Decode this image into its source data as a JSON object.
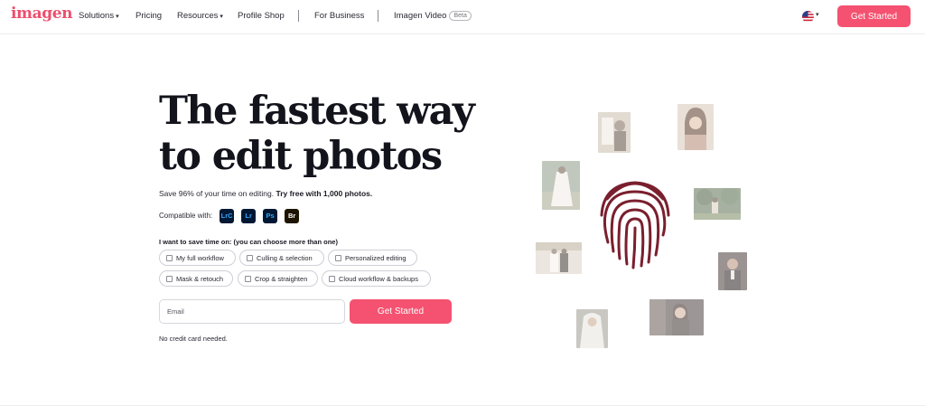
{
  "nav": {
    "logo": "imagen",
    "items": [
      {
        "label": "Solutions",
        "dropdown": true
      },
      {
        "label": "Pricing",
        "dropdown": false
      },
      {
        "label": "Resources",
        "dropdown": true
      },
      {
        "label": "Profile Shop",
        "dropdown": false
      },
      {
        "label": "For Business",
        "dropdown": false
      },
      {
        "label": "Imagen Video",
        "dropdown": false
      }
    ],
    "beta_badge": "Beta",
    "language_icon": "us-flag-icon",
    "cta": "Get Started"
  },
  "hero": {
    "headline_line1": "The fastest way",
    "headline_line2": "to edit photos",
    "sub_text": "Save 96% of your time on editing.",
    "sub_bold": "Try free with 1,000 photos.",
    "compatible_label": "Compatible with:",
    "apps": [
      "LrC",
      "Lr",
      "Ps",
      "Br"
    ],
    "save_time_label": "I want to save time on: (you can choose more than one)",
    "options": [
      "My full workflow",
      "Culling & selection",
      "Personalized editing",
      "Mask & retouch",
      "Crop & straighten",
      "Cloud workflow & backups"
    ],
    "email_placeholder": "Email",
    "cta": "Get Started",
    "note": "No credit card needed."
  },
  "colors": {
    "brand": "#f45270",
    "fingerprint": "#7a1f2e",
    "app_icon_bg": "#001833",
    "app_icon_fg": "#31a8ff"
  },
  "decor": {
    "center_icon": "fingerprint-icon",
    "photos": [
      "wedding-photo",
      "portrait-photo",
      "bride-photo",
      "garden-photo",
      "couple-photo",
      "groom-photo",
      "veil-photo",
      "woman-portrait-photo"
    ]
  }
}
